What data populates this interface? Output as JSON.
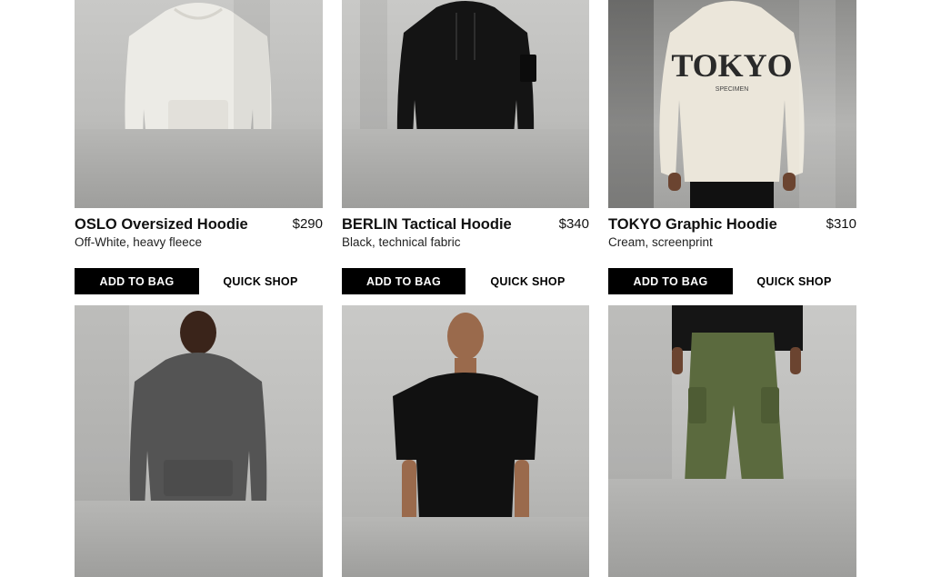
{
  "products": [
    {
      "name": "OSLO Oversized Hoodie",
      "price": "$290",
      "desc": "Off-White, heavy fleece",
      "add": "ADD TO BAG",
      "quick": "QUICK SHOP"
    },
    {
      "name": "BERLIN Tactical Hoodie",
      "price": "$340",
      "desc": "Black, technical fabric",
      "add": "ADD TO BAG",
      "quick": "QUICK SHOP"
    },
    {
      "name": "TOKYO Graphic Hoodie",
      "price": "$310",
      "desc": "Cream, screenprint",
      "add": "ADD TO BAG",
      "quick": "QUICK SHOP"
    }
  ],
  "graphic_print": {
    "main": "TOKYO",
    "small": "SPECIMEN"
  },
  "colors": {
    "offwhite": "#ecebe6",
    "black": "#111111",
    "cream": "#ebe6da",
    "charcoal": "#545454",
    "olive": "#5b6a3e",
    "button": "#000000"
  }
}
